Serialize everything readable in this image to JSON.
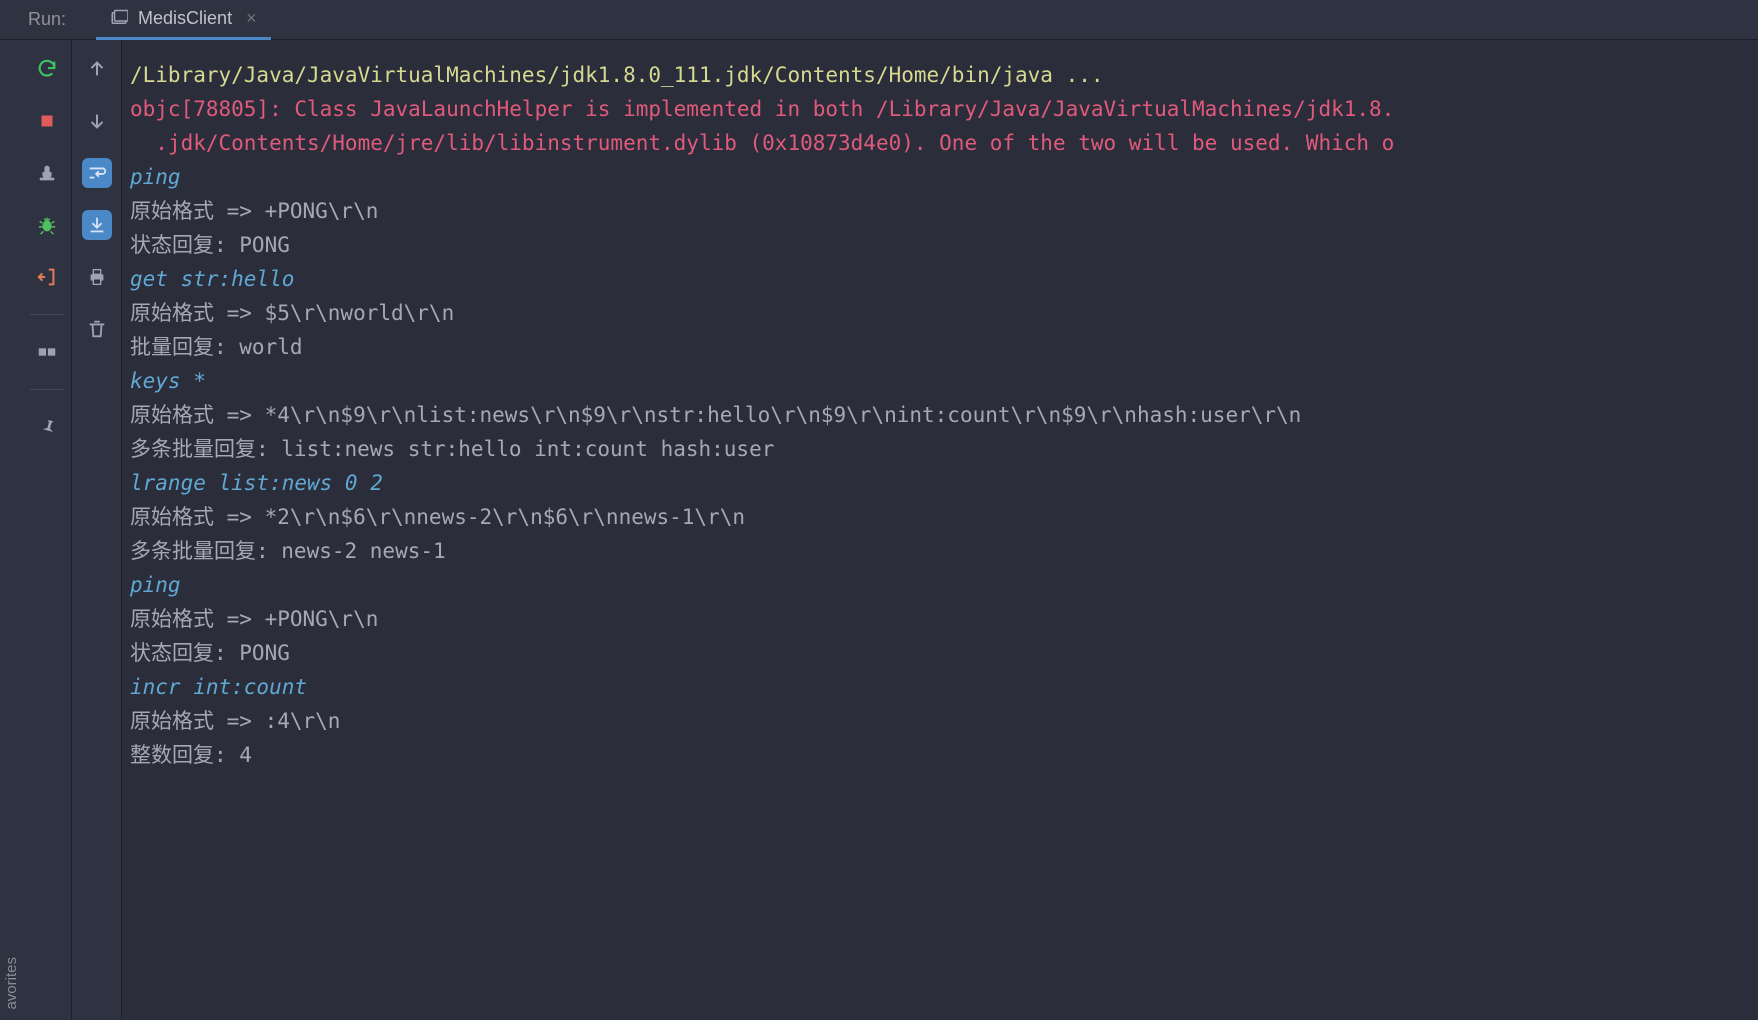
{
  "header": {
    "run_label": "Run:",
    "tab": {
      "title": "MedisClient"
    }
  },
  "sidebar": {
    "favorites_label": "avorites"
  },
  "console": {
    "lines": [
      {
        "cls": "c-cmd",
        "text": "/Library/Java/JavaVirtualMachines/jdk1.8.0_111.jdk/Contents/Home/bin/java ..."
      },
      {
        "cls": "c-err",
        "text": "objc[78805]: Class JavaLaunchHelper is implemented in both /Library/Java/JavaVirtualMachines/jdk1.8."
      },
      {
        "cls": "c-err",
        "text": "  .jdk/Contents/Home/jre/lib/libinstrument.dylib (0x10873d4e0). One of the two will be used. Which o"
      },
      {
        "cls": "c-input",
        "text": "ping"
      },
      {
        "cls": "c-out",
        "text": "原始格式 => +PONG\\r\\n"
      },
      {
        "cls": "c-out",
        "text": "状态回复: PONG"
      },
      {
        "cls": "c-input",
        "text": "get str:hello"
      },
      {
        "cls": "c-out",
        "text": "原始格式 => $5\\r\\nworld\\r\\n"
      },
      {
        "cls": "c-out",
        "text": "批量回复: world"
      },
      {
        "cls": "c-input",
        "text": "keys *"
      },
      {
        "cls": "c-out",
        "text": "原始格式 => *4\\r\\n$9\\r\\nlist:news\\r\\n$9\\r\\nstr:hello\\r\\n$9\\r\\nint:count\\r\\n$9\\r\\nhash:user\\r\\n"
      },
      {
        "cls": "c-out",
        "text": "多条批量回复: list:news str:hello int:count hash:user"
      },
      {
        "cls": "c-input",
        "text": "lrange list:news 0 2"
      },
      {
        "cls": "c-out",
        "text": "原始格式 => *2\\r\\n$6\\r\\nnews-2\\r\\n$6\\r\\nnews-1\\r\\n"
      },
      {
        "cls": "c-out",
        "text": "多条批量回复: news-2 news-1"
      },
      {
        "cls": "c-out",
        "text": ""
      },
      {
        "cls": "c-input",
        "text": "ping"
      },
      {
        "cls": "c-out",
        "text": "原始格式 => +PONG\\r\\n"
      },
      {
        "cls": "c-out",
        "text": "状态回复: PONG"
      },
      {
        "cls": "c-input",
        "text": "incr int:count"
      },
      {
        "cls": "c-out",
        "text": "原始格式 => :4\\r\\n"
      },
      {
        "cls": "c-out",
        "text": "整数回复: 4"
      }
    ]
  }
}
